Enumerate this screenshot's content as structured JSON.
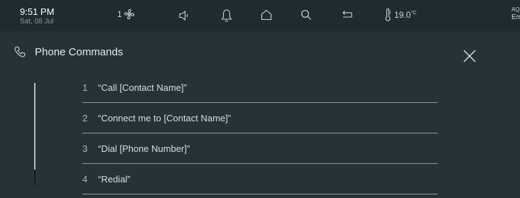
{
  "status_bar": {
    "time": "9:51 PM",
    "date": "Sat, 08 Jul",
    "fan_level": "1",
    "temperature": "19.0",
    "temperature_unit": "°C",
    "corner_line1": "AQI",
    "corner_line2": "Em",
    "icons": [
      "fan-icon",
      "speaker-icon",
      "bell-icon",
      "home-icon",
      "search-icon",
      "back-icon",
      "thermometer-icon"
    ]
  },
  "panel": {
    "title": "Phone Commands",
    "title_icon": "phone-icon",
    "close_icon": "close-icon",
    "commands": [
      {
        "num": "1",
        "text": "“Call [Contact Name]”"
      },
      {
        "num": "2",
        "text": "“Connect me to [Contact Name]”"
      },
      {
        "num": "3",
        "text": "“Dial [Phone Number]”"
      },
      {
        "num": "4",
        "text": "“Redial”"
      }
    ]
  },
  "colors": {
    "status_bg": "#1e2b30",
    "panel_bg": "#263237",
    "text": "#d8dfe2",
    "divider": "#8f9ba0"
  }
}
